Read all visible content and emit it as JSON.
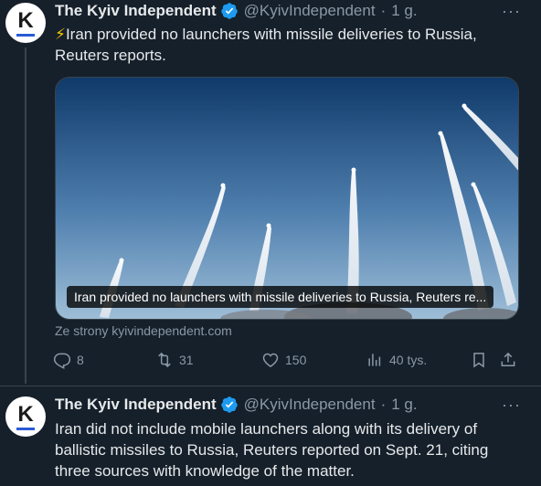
{
  "tweets": [
    {
      "author_name": "The Kyiv Independent",
      "handle": "@KyivIndependent",
      "separator": "·",
      "time": "1 g.",
      "avatar_letter": "K",
      "text": "⚡Iran provided no launchers with missile deliveries to Russia, Reuters reports.",
      "card": {
        "caption": "Iran provided no launchers with missile deliveries to Russia, Reuters re...",
        "source": "Ze strony kyivindependent.com"
      },
      "actions": {
        "replies": "8",
        "retweets": "31",
        "likes": "150",
        "views": "40 tys."
      }
    },
    {
      "author_name": "The Kyiv Independent",
      "handle": "@KyivIndependent",
      "separator": "·",
      "time": "1 g.",
      "avatar_letter": "K",
      "text": "Iran did not include mobile launchers along with its delivery of ballistic missiles to Russia, Reuters reported on Sept. 21, citing three sources with knowledge of the matter."
    }
  ],
  "colors": {
    "background": "#15202b",
    "text_primary": "#e7e9ea",
    "text_secondary": "#8b98a5",
    "verified": "#1d9bf0",
    "border": "#38444d"
  },
  "icons": {
    "verified": "verified-badge-icon",
    "more": "more-options-icon",
    "reply": "reply-icon",
    "retweet": "retweet-icon",
    "like": "heart-icon",
    "views": "views-icon",
    "bookmark": "bookmark-icon",
    "share": "share-icon"
  }
}
